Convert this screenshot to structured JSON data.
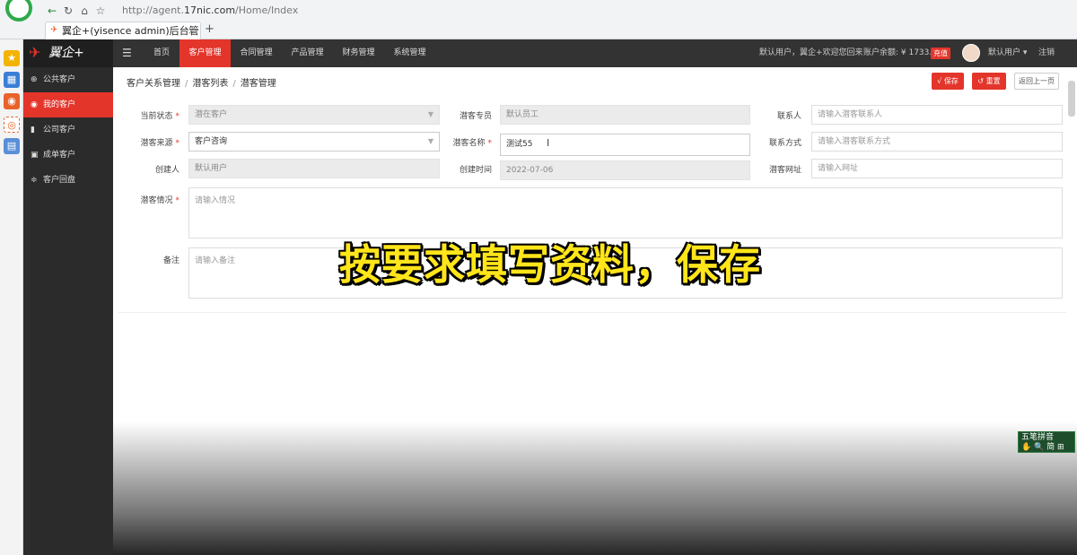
{
  "browser": {
    "url_prefix": "http://agent.",
    "url_domain": "17nic.com",
    "url_path": "/Home/Index",
    "tab_title": "翼企+(yisence admin)后台管理",
    "tab_close": "×",
    "new_tab": "+"
  },
  "app": {
    "logo_text": "翼企+",
    "sidebar": {
      "items": [
        {
          "label": "公共客户",
          "icon": "globe-icon"
        },
        {
          "label": "我的客户",
          "icon": "user-circle-icon"
        },
        {
          "label": "公司客户",
          "icon": "bar-chart-icon"
        },
        {
          "label": "成单客户",
          "icon": "picture-icon"
        },
        {
          "label": "客户回盘",
          "icon": "sliders-icon"
        }
      ]
    },
    "topnav": {
      "items": [
        {
          "label": "首页"
        },
        {
          "label": "客户管理"
        },
        {
          "label": "合同管理"
        },
        {
          "label": "产品管理"
        },
        {
          "label": "财务管理"
        },
        {
          "label": "系统管理"
        }
      ],
      "welcome": "默认用户，翼企+欢迎您回来",
      "balance": "账户余额: ¥ 1733.06",
      "recharge": "充值",
      "username": "默认用户 ▾",
      "logout": "注销"
    }
  },
  "page": {
    "breadcrumb": [
      "客户关系管理",
      "潜客列表",
      "潜客管理"
    ],
    "breadcrumb_sep": "/",
    "buttons": {
      "save": "√ 保存",
      "reset": "↺ 重置",
      "back": "返回上一页"
    },
    "form": {
      "status": {
        "label": "当前状态",
        "value": "潜在客户"
      },
      "rep": {
        "label": "潜客专员",
        "value": "默认员工"
      },
      "contact": {
        "label": "联系人",
        "placeholder": "请输入潜客联系人"
      },
      "source": {
        "label": "潜客来源",
        "value": "客户咨询"
      },
      "name": {
        "label": "潜客名称",
        "value": "测试55"
      },
      "contact_method": {
        "label": "联系方式",
        "placeholder": "请输入潜客联系方式"
      },
      "creator": {
        "label": "创建人",
        "value": "默认用户"
      },
      "created_at": {
        "label": "创建时间",
        "value": "2022-07-06"
      },
      "website": {
        "label": "潜客网址",
        "placeholder": "请输入网址"
      },
      "situation": {
        "label": "潜客情况",
        "placeholder": "请输入情况"
      },
      "remark": {
        "label": "备注",
        "placeholder": "请输入备注"
      },
      "required_mark": "*"
    }
  },
  "overlay_caption": "按要求填写资料，保存",
  "ime": {
    "title": "五笔拼音",
    "tools": "✋ 🔍 简 ⊞"
  },
  "colors": {
    "accent": "#e4352b",
    "sidebar": "#2b2b2b",
    "topbar": "#333333"
  }
}
